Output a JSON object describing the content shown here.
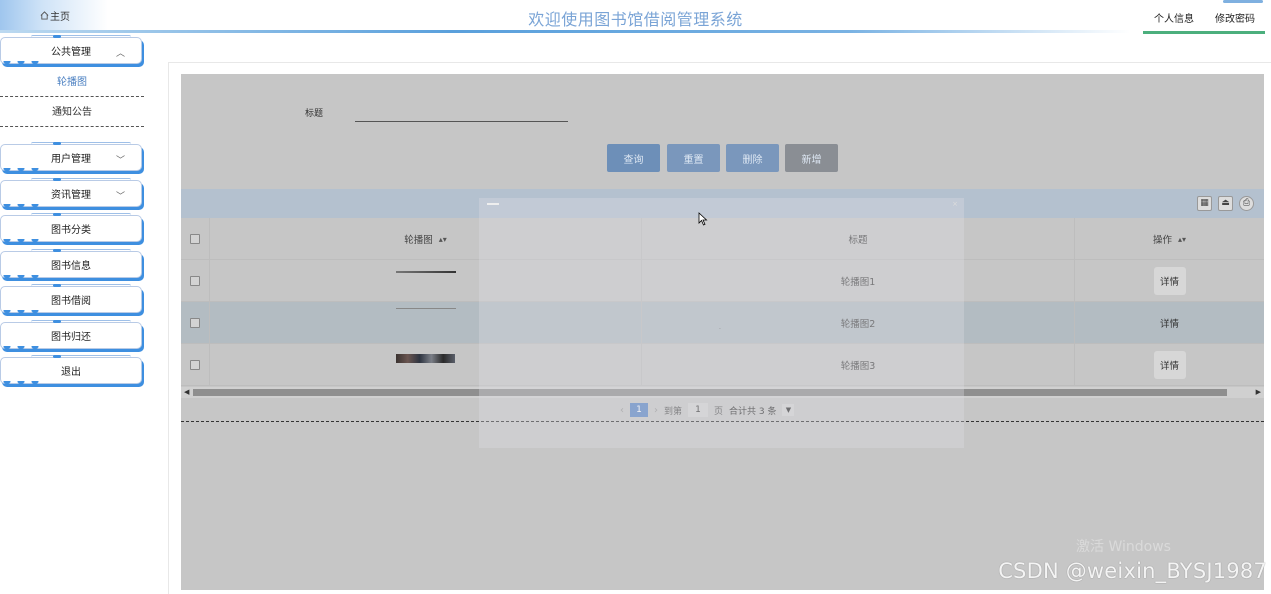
{
  "header": {
    "home_label": "主页",
    "site_title": "欢迎使用图书馆借阅管理系统",
    "profile_label": "个人信息",
    "change_password_label": "修改密码"
  },
  "sidebar": {
    "public_mgmt": "公共管理",
    "sub_items": [
      "轮播图",
      "通知公告"
    ],
    "user_mgmt": "用户管理",
    "news_mgmt": "资讯管理",
    "book_category": "图书分类",
    "book_info": "图书信息",
    "book_borrow": "图书借阅",
    "book_return": "图书归还",
    "logout": "退出"
  },
  "search": {
    "label": "标题",
    "value": ""
  },
  "buttons": {
    "query": "查询",
    "reset": "重置",
    "delete": "删除",
    "add": "新增"
  },
  "table": {
    "headers": {
      "image": "轮播图",
      "title": "标题",
      "action": "操作"
    },
    "rows": [
      {
        "title": "轮播图1",
        "action": "详情"
      },
      {
        "title": "轮播图2",
        "action": "详情"
      },
      {
        "title": "轮播图3",
        "action": "详情"
      }
    ]
  },
  "pagination": {
    "current_page": "1",
    "goto_label": "到第",
    "goto_value": "1",
    "page_unit": "页",
    "total_text": "合计共 3 条"
  },
  "watermarks": {
    "windows": "激活 Windows",
    "csdn": "CSDN @weixin_BYSJ1987"
  },
  "colors": {
    "accent": "#5c86c4",
    "menu_shadow": "#3e8fe0",
    "title": "#7aa4d6"
  }
}
